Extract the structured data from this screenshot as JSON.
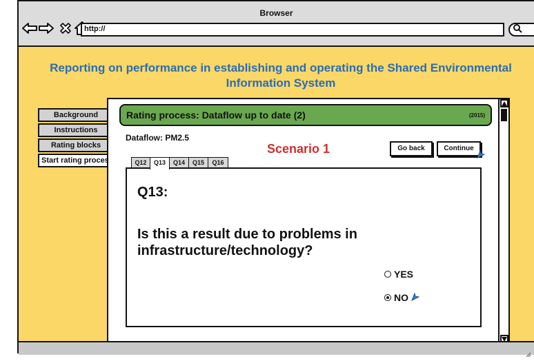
{
  "window": {
    "title": "Browser",
    "url": "http://"
  },
  "icons": {
    "back": "back-arrow-icon",
    "forward": "forward-arrow-icon",
    "stop": "close-icon",
    "home": "home-icon",
    "search": "search-icon"
  },
  "page": {
    "heading_line1": "Reporting on performance in establishing and operating the Shared Environmental",
    "heading_line2": "Information System"
  },
  "sidebar": {
    "items": [
      {
        "label": "Background",
        "active": false
      },
      {
        "label": "Instructions",
        "active": false
      },
      {
        "label": "Rating blocks",
        "active": false
      },
      {
        "label": "Start rating process",
        "active": true
      }
    ]
  },
  "panel": {
    "header_title": "Rating process: Dataflow up to date (2)",
    "header_year": "(2015)",
    "dataflow_label": "Dataflow: PM2.5",
    "scenario": "Scenario 1",
    "go_back_label": "Go back",
    "continue_label": "Continue",
    "tabs": [
      "Q12",
      "Q13",
      "Q14",
      "Q15",
      "Q16"
    ],
    "active_tab": "Q13",
    "question_number": "Q13:",
    "question_line1": "Is this a result due to problems in",
    "question_line2": "infrastructure/technology?",
    "options": [
      {
        "label": "YES",
        "selected": false
      },
      {
        "label": "NO",
        "selected": true
      }
    ]
  },
  "colors": {
    "page_background": "#fad766",
    "heading": "#2a6db5",
    "header_green": "#6aa84f",
    "scenario_red": "#d0302f",
    "cursor_blue": "#3a7fd0"
  }
}
